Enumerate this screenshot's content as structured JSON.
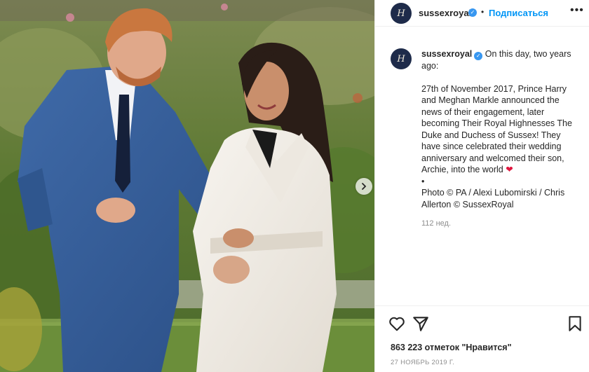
{
  "header": {
    "username": "sussexroyal",
    "separator": "•",
    "follow_label": "Подписаться",
    "more_label": "•••",
    "avatar_monogram": "H"
  },
  "caption": {
    "username": "sussexroyal",
    "intro": "On this day, two years ago:",
    "body": "27th of November 2017, Prince Harry and Meghan Markle announced the news of their engagement, later becoming Their Royal Highnesses The Duke and Duchess of Sussex! They have since celebrated their wedding anniversary and welcomed their son, Archie, into the world",
    "emoji": "❤",
    "bullet": "•",
    "credits": "Photo © PA / Alexi Lubomirski / Chris Allerton © SussexRoyal",
    "time_ago": "112 нед."
  },
  "footer": {
    "likes": "863 223 отметок \"Нравится\"",
    "date": "27 НОЯБРЬ 2019 Г."
  },
  "icons": {
    "verified": "verified-badge-icon",
    "next": "chevron-right-icon",
    "like": "heart-outline-icon",
    "share": "paper-plane-icon",
    "save": "bookmark-outline-icon"
  },
  "colors": {
    "link": "#0095f6",
    "verified": "#3897f0",
    "avatar_bg": "#1e2b4a",
    "muted": "#8e8e8e"
  }
}
